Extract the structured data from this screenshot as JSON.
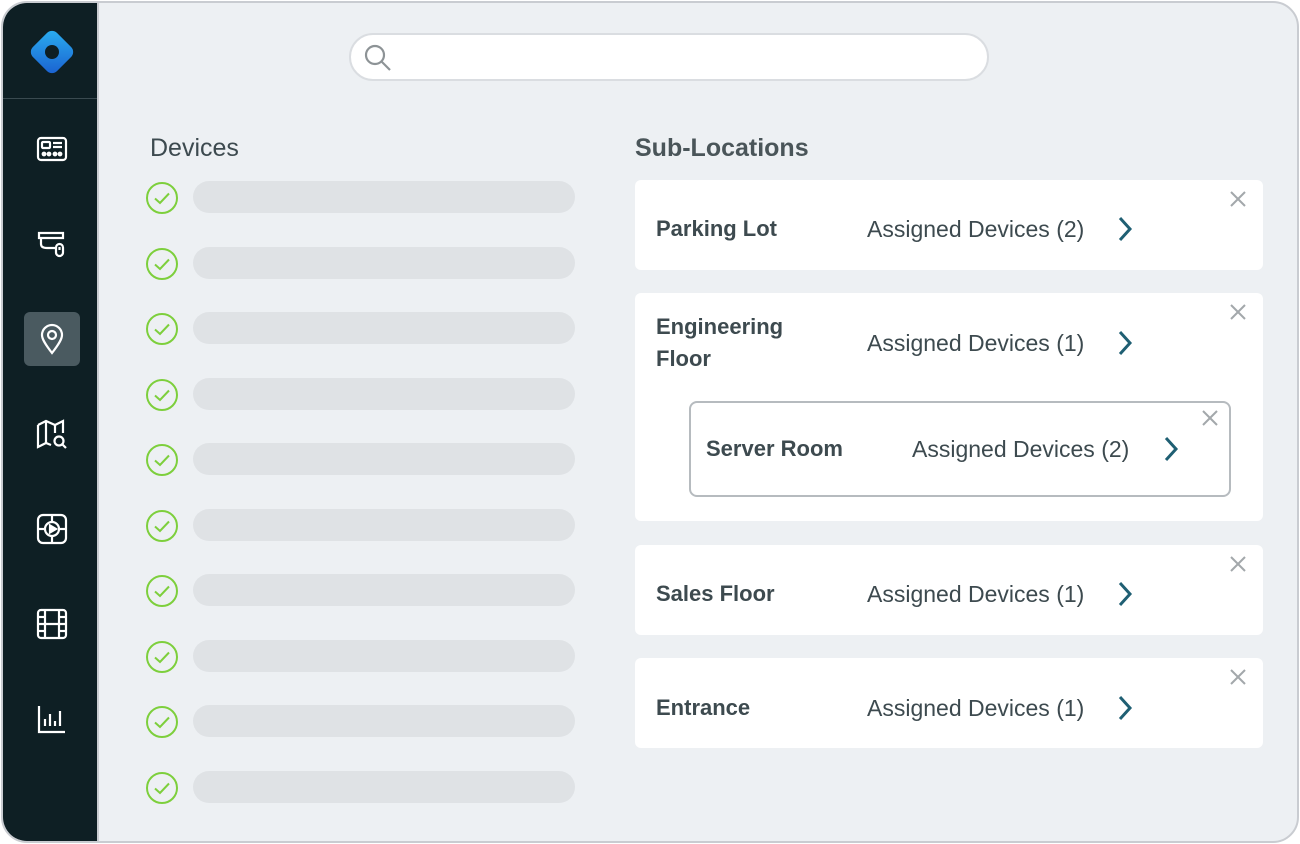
{
  "search": {
    "placeholder": "",
    "value": ""
  },
  "sidebar": {
    "items": [
      {
        "icon": "dashboard-icon",
        "active": false
      },
      {
        "icon": "camera-icon",
        "active": false
      },
      {
        "icon": "location-pin-icon",
        "active": true
      },
      {
        "icon": "map-search-icon",
        "active": false
      },
      {
        "icon": "video-play-icon",
        "active": false
      },
      {
        "icon": "film-icon",
        "active": false
      },
      {
        "icon": "bar-chart-icon",
        "active": false
      }
    ]
  },
  "devices": {
    "heading": "Devices",
    "count": 10
  },
  "sublocations": {
    "heading": "Sub-Locations",
    "cards": [
      {
        "name": "Parking Lot",
        "assigned": "Assigned Devices (2)"
      },
      {
        "name": "Engineering Floor",
        "assigned": "Assigned Devices (1)",
        "child": {
          "name": "Server Room",
          "assigned": "Assigned Devices (2)"
        }
      },
      {
        "name": "Sales Floor",
        "assigned": "Assigned Devices (1)"
      },
      {
        "name": "Entrance",
        "assigned": "Assigned Devices (1)"
      }
    ]
  },
  "colors": {
    "sidebar_bg": "#0e1f24",
    "accent": "#1f5f73",
    "check_green": "#7dcf3c",
    "logo_blue": "#1e8ce0"
  }
}
